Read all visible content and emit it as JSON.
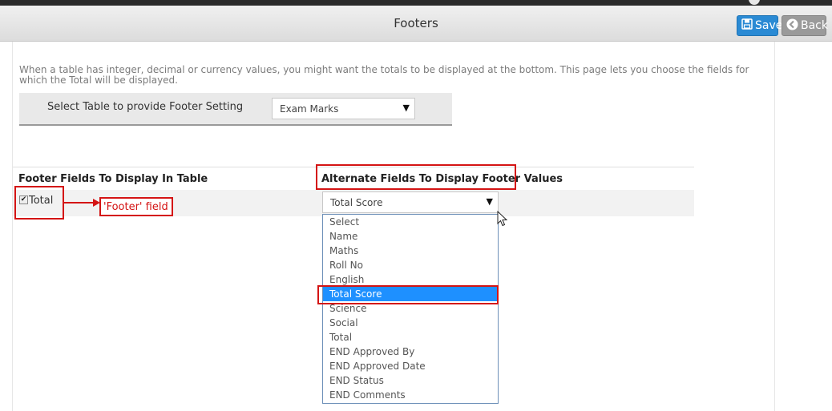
{
  "header": {
    "title": "Footers",
    "save_label": "Save",
    "back_label": "Back"
  },
  "description": "When a table has integer, decimal or currency values, you might want the totals to be displayed at the bottom. This page lets you choose the fields for which the Total will be displayed.",
  "table_select": {
    "label": "Select Table to provide Footer Setting",
    "value": "Exam Marks"
  },
  "columns": {
    "footer_fields": "Footer Fields To Display In Table",
    "alternate_fields": "Alternate Fields To Display Footer Values"
  },
  "row": {
    "checkbox_checked": true,
    "checkbox_label": "Total",
    "callout": "'Footer' field",
    "alternate_value": "Total Score"
  },
  "dropdown": {
    "options": [
      "Select",
      "Name",
      "Maths",
      "Roll No",
      "English",
      "Total Score",
      "Science",
      "Social",
      "Total",
      "END Approved By",
      "END Approved Date",
      "END Status",
      "END Comments"
    ],
    "selected": "Total Score"
  },
  "colors": {
    "save_button": "#2a8ad4",
    "back_button": "#9a9a9a",
    "annotation_red": "#d41414",
    "highlight": "#1e90ff"
  }
}
